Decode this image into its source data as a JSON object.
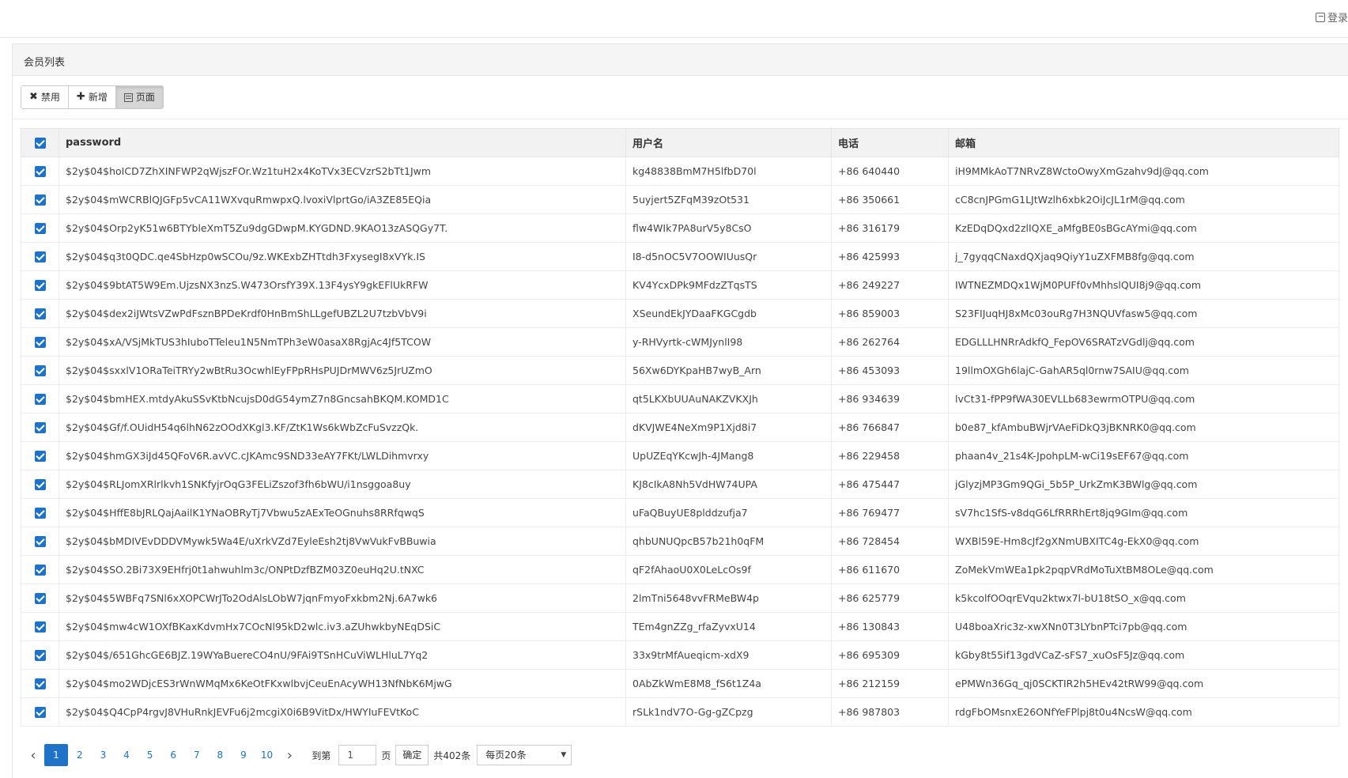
{
  "header": {
    "login_label": "登录"
  },
  "panel": {
    "title": "会员列表"
  },
  "toolbar": {
    "disable_label": "禁用",
    "add_label": "新增",
    "page_label": "页面"
  },
  "table": {
    "columns": [
      "password",
      "用户名",
      "电话",
      "邮箱"
    ],
    "rows": [
      [
        "$2y$04$hoICD7ZhXINFWP2qWjszFOr.Wz1tuH2x4KoTVx3ECVzrS2bTt1Jwm",
        "kg48838BmM7H5lfbD70l",
        "+86 640440",
        "iH9MMkAoT7NRvZ8WctoOwyXmGzahv9dJ@qq.com"
      ],
      [
        "$2y$04$mWCRBlQJGFp5vCA11WXvquRmwpxQ.lvoxiVlprtGo/iA3ZE85EQia",
        "5uyjert5ZFqM39zOt531",
        "+86 350661",
        "cC8cnJPGmG1LJtWzlh6xbk2OiJcJL1rM@qq.com"
      ],
      [
        "$2y$04$Orp2yK51w6BTYbleXmT5Zu9dgGDwpM.KYGDND.9KAO13zASQGy7T.",
        "flw4WIk7PA8urV5y8CsO",
        "+86 316179",
        "KzEDqDQxd2zlIQXE_aMfgBE0sBGcAYmi@qq.com"
      ],
      [
        "$2y$04$q3t0QDC.qe4SbHzp0wSCOu/9z.WKExbZHTtdh3FxysegI8xVYk.IS",
        "I8-d5nOC5V7OOWIUusQr",
        "+86 425993",
        "j_7gyqqCNaxdQXjaq9QiyY1uZXFMB8fg@qq.com"
      ],
      [
        "$2y$04$9btAT5W9Em.UjzsNX3nzS.W473OrsfY39X.13F4ysY9gkEFlUkRFW",
        "KV4YcxDPk9MFdzZTqsTS",
        "+86 249227",
        "IWTNEZMDQx1WjM0PUFf0vMhhslQUI8j9@qq.com"
      ],
      [
        "$2y$04$dex2iJWtsVZwPdFsznBPDeKrdf0HnBmShLLgefUBZL2U7tzbVbV9i",
        "XSeundEkJYDaaFKGCgdb",
        "+86 859003",
        "S23FIJuqHJ8xMc03ouRg7H3NQUVfasw5@qq.com"
      ],
      [
        "$2y$04$xA/VSjMkTUS3hIuboTTeleu1N5NmTPh3eW0asaX8RgjAc4Jf5TCOW",
        "y-RHVyrtk-cWMJynlI98",
        "+86 262764",
        "EDGLLLHNRrAdkfQ_FepOV6SRATzVGdlj@qq.com"
      ],
      [
        "$2y$04$sxxlV1ORaTeiTRYy2wBtRu3OcwhlEyFPpRHsPUJDrMWV6z5JrUZmO",
        "56Xw6DYKpaHB7wyB_Arn",
        "+86 453093",
        "19llmOXGh6lajC-GahAR5ql0rnw7SAIU@qq.com"
      ],
      [
        "$2y$04$bmHEX.mtdyAkuSSvKtbNcujsD0dG54ymZ7n8GncsahBKQM.KOMD1C",
        "qt5LKXbUUAuNAKZVKXJh",
        "+86 934639",
        "lvCt31-fPP9fWA30EVLLb683ewrmOTPU@qq.com"
      ],
      [
        "$2y$04$Gf/f.OUidH54q6lhN62zOOdXKgl3.KF/ZtK1Ws6kWbZcFuSvzzQk.",
        "dKVJWE4NeXm9P1Xjd8i7",
        "+86 766847",
        "b0e87_kfAmbuBWjrVAeFiDkQ3jBKNRK0@qq.com"
      ],
      [
        "$2y$04$hmGX3iJd45QFoV6R.avVC.cJKAmc9SND33eAY7FKt/LWLDihmvrxy",
        "UpUZEqYKcwJh-4JMang8",
        "+86 229458",
        "phaan4v_21s4K-JpohpLM-wCi19sEF67@qq.com"
      ],
      [
        "$2y$04$RLJomXRlrlkvh1SNKfyjrOqG3FELiZszof3fh6bWU/i1nsggoa8uy",
        "KJ8cIkA8Nh5VdHW74UPA",
        "+86 475447",
        "jGlyzjMP3Gm9QGi_5b5P_UrkZmK3BWlg@qq.com"
      ],
      [
        "$2y$04$HffE8bJRLQajAailK1YNaOBRyTj7Vbwu5zAExTeOGnuhs8RRfqwqS",
        "uFaQBuyUE8plddzufja7",
        "+86 769477",
        "sV7hc1SfS-v8dqG6LfRRRhErt8jq9GIm@qq.com"
      ],
      [
        "$2y$04$bMDIVEvDDDVMywk5Wa4E/uXrkVZd7EyleEsh2tj8VwVukFvBBuwia",
        "qhbUNUQpcB57b21h0qFM",
        "+86 728454",
        "WXBl59E-Hm8cJf2gXNmUBXITC4g-EkX0@qq.com"
      ],
      [
        "$2y$04$SO.2Bi73X9EHfrj0t1ahwuhlm3c/ONPtDzfBZM03Z0euHq2U.tNXC",
        "qF2fAhaoU0X0LeLcOs9f",
        "+86 611670",
        "ZoMekVmWEa1pk2pqpVRdMoTuXtBM8OLe@qq.com"
      ],
      [
        "$2y$04$5WBFq7SNl6xXOPCWrJTo2OdAlsLObW7jqnFmyoFxkbm2Nj.6A7wk6",
        "2lmTni5648vvFRMeBW4p",
        "+86 625779",
        "k5kcolfOOqrEVqu2ktwx7l-bU18tSO_x@qq.com"
      ],
      [
        "$2y$04$mw4cW1OXfBKaxKdvmHx7COcNl95kD2wlc.iv3.aZUhwkbyNEqDSiC",
        "TEm4gnZZg_rfaZyvxU14",
        "+86 130843",
        "U48boaXric3z-xwXNn0T3LYbnPTci7pb@qq.com"
      ],
      [
        "$2y$04$/651GhcGE6BJZ.19WYaBuereCO4nU/9FAi9TSnHCuViWLHluL7Yq2",
        "33x9trMfAueqicm-xdX9",
        "+86 695309",
        "kGby8t55if13gdVCaZ-sFS7_xuOsF5Jz@qq.com"
      ],
      [
        "$2y$04$mo2WDjcES3rWnWMqMx6KeOtFKxwlbvjCeuEnAcyWH13NfNbK6MjwG",
        "0AbZkWmE8M8_fS6t1Z4a",
        "+86 212159",
        "ePMWn36Gq_qj0SCKTIR2h5HEv42tRW99@qq.com"
      ],
      [
        "$2y$04$Q4CpP4rgvJ8VHuRnkJEVFu6j2mcgiX0i6B9VitDx/HWYIuFEVtKoC",
        "rSLk1ndV7O-Gg-gZCpzg",
        "+86 987803",
        "rdgFbOMsnxE26ONfYeFPlpj8t0u4NcsW@qq.com"
      ]
    ]
  },
  "pagination": {
    "pages": [
      "1",
      "2",
      "3",
      "4",
      "5",
      "6",
      "7",
      "8",
      "9",
      "10"
    ],
    "current": "1",
    "goto_label": "到第",
    "goto_value": "1",
    "page_unit": "页",
    "confirm_label": "确定",
    "total_label": "共402条",
    "per_page_label": "每页20条"
  },
  "colors": {
    "accent": "#1e73c8"
  }
}
